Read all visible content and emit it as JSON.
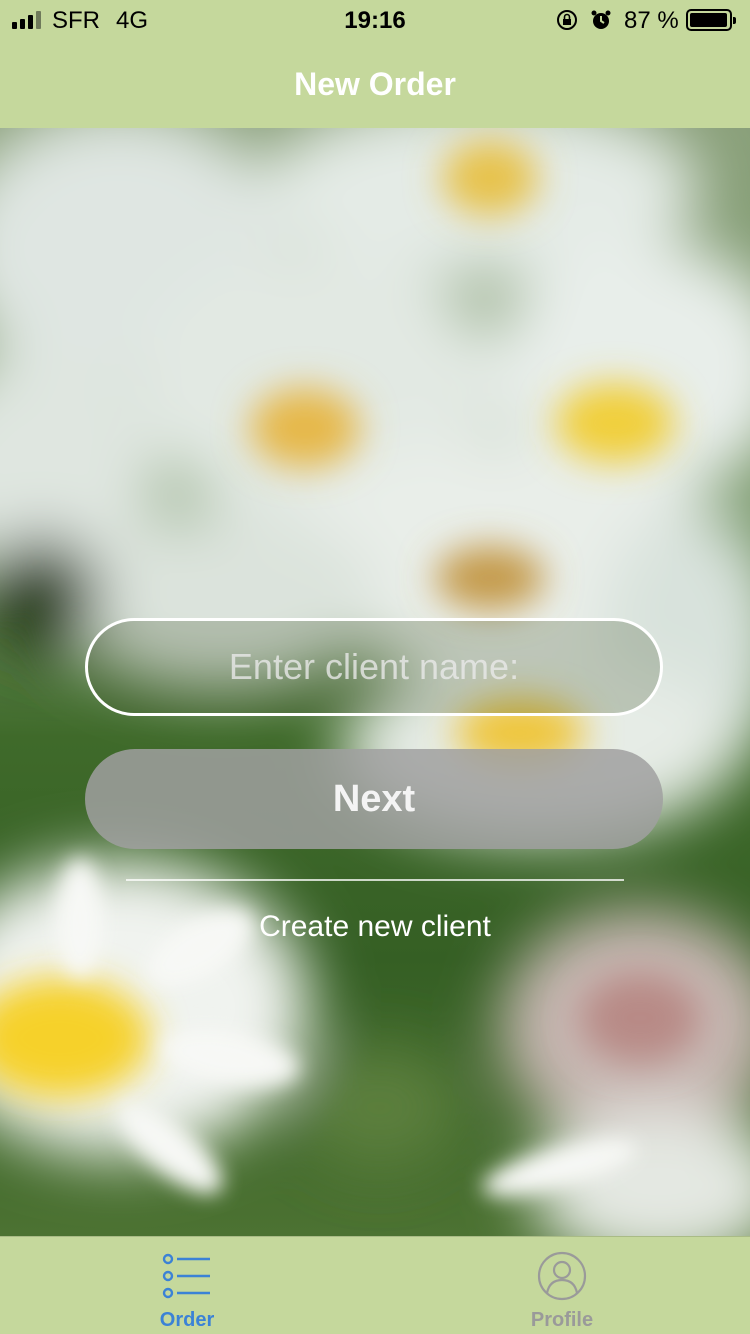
{
  "status_bar": {
    "carrier": "SFR",
    "network": "4G",
    "time": "19:16",
    "battery_percent": "87 %",
    "battery_level": 0.87,
    "icons": [
      "signal-icon",
      "orientation-lock-icon",
      "alarm-icon",
      "battery-icon"
    ]
  },
  "nav": {
    "title": "New Order"
  },
  "form": {
    "client_placeholder": "Enter client name:",
    "client_value": "",
    "next_label": "Next",
    "create_client_label": "Create new client"
  },
  "tabs": [
    {
      "label": "Order",
      "icon": "list-icon",
      "active": true
    },
    {
      "label": "Profile",
      "icon": "profile-icon",
      "active": false
    }
  ],
  "colors": {
    "bar_background": "#c5d89c",
    "active_tab": "#3b82d6",
    "inactive_tab": "#9a9a9a"
  }
}
